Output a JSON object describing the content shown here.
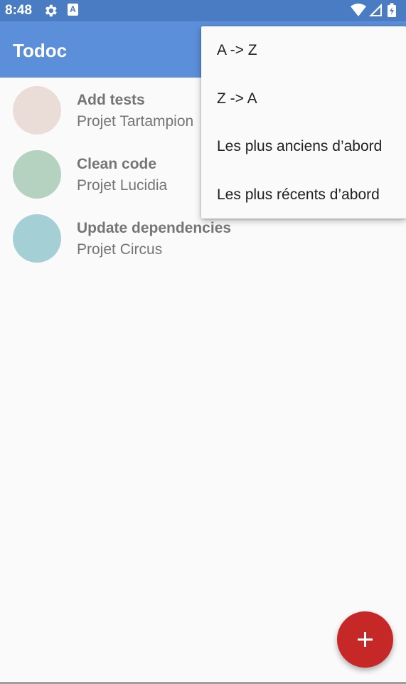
{
  "status_bar": {
    "time": "8:48",
    "notification_badge": "A",
    "icons": [
      "gear-icon",
      "a-notification-icon",
      "wifi-icon",
      "signal-icon",
      "battery-icon"
    ]
  },
  "app_bar": {
    "title": "Todoc"
  },
  "tasks": [
    {
      "name": "Add tests",
      "project": "Projet Tartampion",
      "color": "#eadcd6"
    },
    {
      "name": "Clean code",
      "project": "Projet Lucidia",
      "color": "#b5d2c0"
    },
    {
      "name": "Update dependencies",
      "project": "Projet Circus",
      "color": "#a4d0d5"
    }
  ],
  "sort_menu": {
    "items": [
      "A -> Z",
      "Z -> A",
      "Les plus anciens d’abord",
      "Les plus récents d’abord"
    ]
  },
  "fab": {
    "icon": "plus-icon",
    "color": "#c62828"
  },
  "colors": {
    "status_bar": "#4a7cc4",
    "app_bar": "#5b8fd9",
    "background": "#fafafa",
    "accent": "#c62828"
  }
}
